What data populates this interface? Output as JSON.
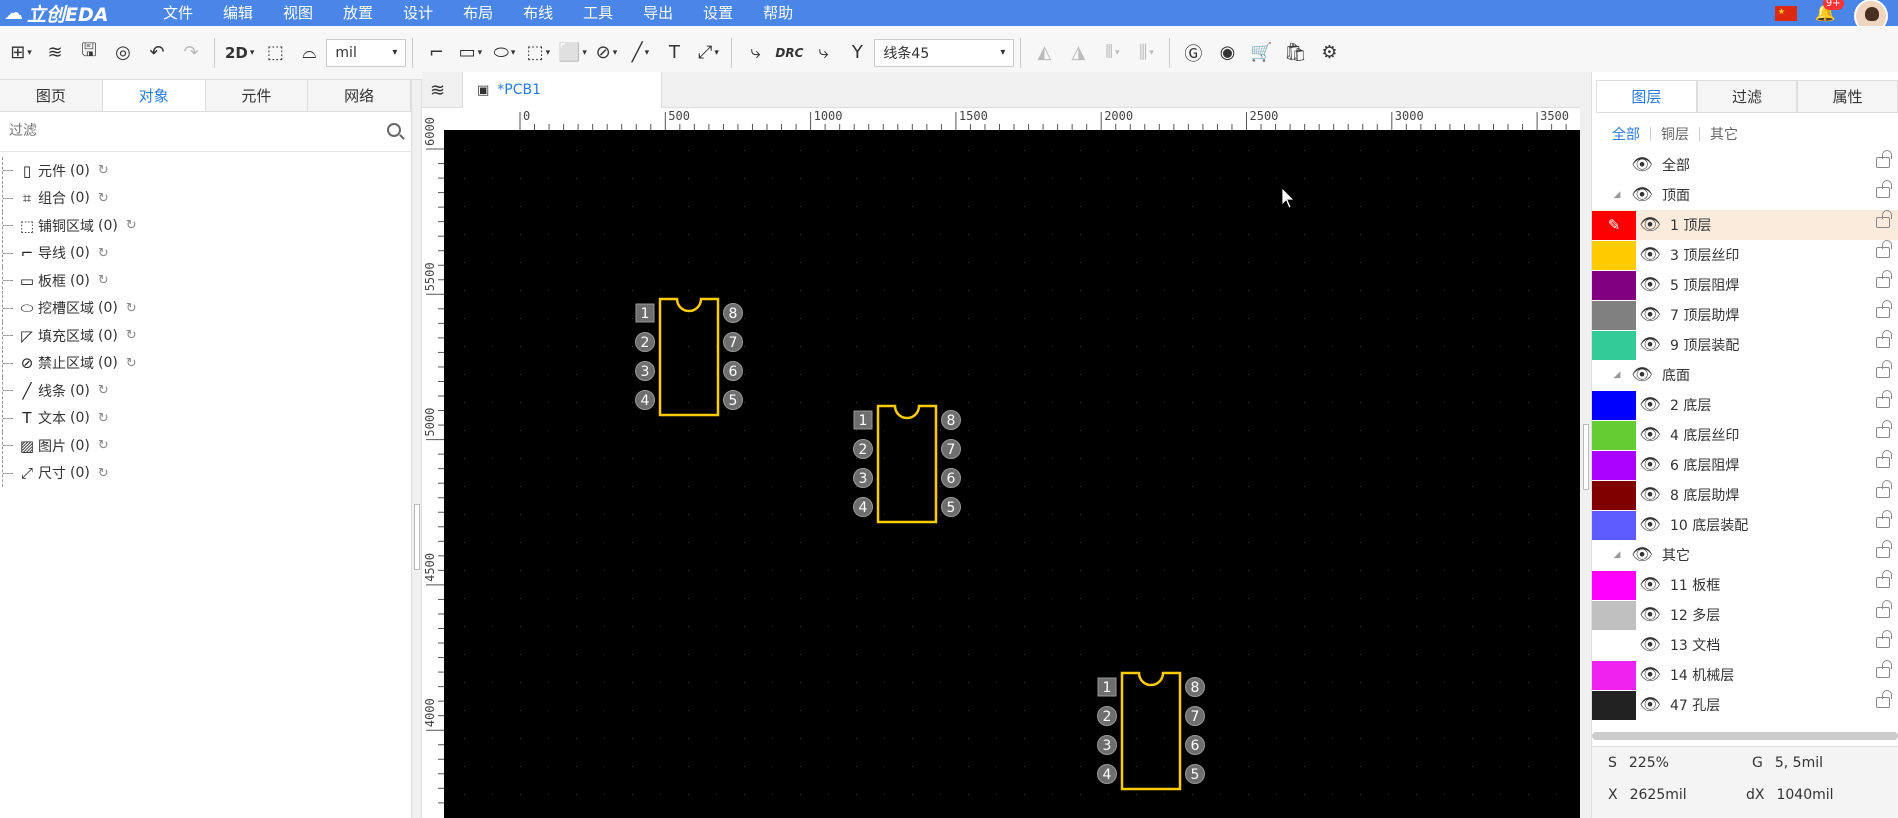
{
  "brand": {
    "name": "立创EDA"
  },
  "menu": [
    "文件",
    "编辑",
    "视图",
    "放置",
    "设计",
    "布局",
    "布线",
    "工具",
    "导出",
    "设置",
    "帮助"
  ],
  "notifications": {
    "badge": "9+"
  },
  "toolbar": {
    "view_mode": "2D",
    "unit": "mil",
    "drc_label": "DRC",
    "routing_mode": "线条45"
  },
  "left_panel": {
    "tabs": [
      "图页",
      "对象",
      "元件",
      "网络"
    ],
    "active_tab": "对象",
    "filter_placeholder": "过滤",
    "tree": [
      {
        "label": "元件",
        "count": "(0)",
        "icon": "component-icon"
      },
      {
        "label": "组合",
        "count": "(0)",
        "icon": "group-icon"
      },
      {
        "label": "铺铜区域",
        "count": "(0)",
        "icon": "copper-pour-icon"
      },
      {
        "label": "导线",
        "count": "(0)",
        "icon": "track-icon"
      },
      {
        "label": "板框",
        "count": "(0)",
        "icon": "board-outline-icon"
      },
      {
        "label": "挖槽区域",
        "count": "(0)",
        "icon": "slot-region-icon"
      },
      {
        "label": "填充区域",
        "count": "(0)",
        "icon": "fill-region-icon"
      },
      {
        "label": "禁止区域",
        "count": "(0)",
        "icon": "keepout-icon"
      },
      {
        "label": "线条",
        "count": "(0)",
        "icon": "line-icon"
      },
      {
        "label": "文本",
        "count": "(0)",
        "icon": "text-icon"
      },
      {
        "label": "图片",
        "count": "(0)",
        "icon": "image-icon"
      },
      {
        "label": "尺寸",
        "count": "(0)",
        "icon": "dimension-icon"
      }
    ]
  },
  "document": {
    "tab_name": "*PCB1"
  },
  "canvas": {
    "ruler_x": [
      "0",
      "500",
      "1000",
      "1500",
      "2000",
      "2500",
      "3000",
      "3500"
    ],
    "ruler_y": [
      "6000",
      "5500",
      "5000",
      "4500",
      "4000"
    ],
    "footprint_pins_left": [
      "1",
      "2",
      "3",
      "4"
    ],
    "footprint_pins_right": [
      "8",
      "7",
      "6",
      "5"
    ]
  },
  "right_panel": {
    "tabs": [
      "图层",
      "过滤",
      "属性"
    ],
    "active_tab": "图层",
    "subtabs": [
      "全部",
      "铜层",
      "其它"
    ],
    "layers": [
      {
        "type": "group",
        "label": "全部",
        "nochevron": true
      },
      {
        "type": "group",
        "label": "顶面"
      },
      {
        "type": "layer",
        "label": "1 顶层",
        "color": "#ff0000",
        "selected": true
      },
      {
        "type": "layer",
        "label": "3 顶层丝印",
        "color": "#ffcc00"
      },
      {
        "type": "layer",
        "label": "5 顶层阻焊",
        "color": "#800080"
      },
      {
        "type": "layer",
        "label": "7 顶层助焊",
        "color": "#808080"
      },
      {
        "type": "layer",
        "label": "9 顶层装配",
        "color": "#33cc99"
      },
      {
        "type": "group",
        "label": "底面"
      },
      {
        "type": "layer",
        "label": "2 底层",
        "color": "#0000ff"
      },
      {
        "type": "layer",
        "label": "4 底层丝印",
        "color": "#66cc33"
      },
      {
        "type": "layer",
        "label": "6 底层阻焊",
        "color": "#aa00ff"
      },
      {
        "type": "layer",
        "label": "8 底层助焊",
        "color": "#800000"
      },
      {
        "type": "layer",
        "label": "10 底层装配",
        "color": "#5c5cff"
      },
      {
        "type": "group",
        "label": "其它"
      },
      {
        "type": "layer",
        "label": "11 板框",
        "color": "#ff00ff"
      },
      {
        "type": "layer",
        "label": "12 多层",
        "color": "#c0c0c0"
      },
      {
        "type": "layer",
        "label": "13 文档",
        "color": "#ffffff"
      },
      {
        "type": "layer",
        "label": "14 机械层",
        "color": "#f022f0"
      },
      {
        "type": "layer",
        "label": "47 孔层",
        "color": "#222222"
      }
    ]
  },
  "status": {
    "s_label": "S",
    "s_value": "225%",
    "g_label": "G",
    "g_value": "5, 5mil",
    "x_label": "X",
    "x_value": "2625mil",
    "dx_label": "dX",
    "dx_value": "1040mil"
  }
}
